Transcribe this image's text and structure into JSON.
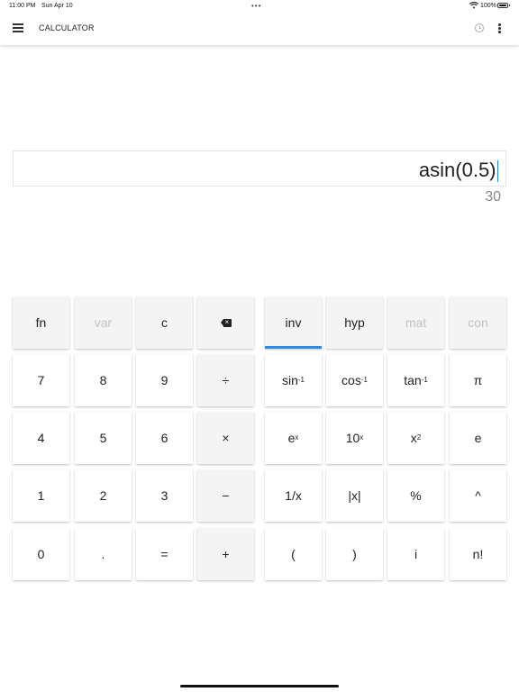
{
  "status_bar": {
    "time": "11:00 PM",
    "date": "Sun Apr 10",
    "battery": "100%",
    "battery_level": 1.0
  },
  "app_bar": {
    "title": "CALCULATOR",
    "icons": [
      "menu-icon",
      "history-icon",
      "more-vert-icon"
    ]
  },
  "display": {
    "expression": "asin(0.5)",
    "result": "30"
  },
  "accent_color": "#2a8ae4",
  "keypad": {
    "left": {
      "top_row": [
        {
          "label": "fn",
          "state": "normal"
        },
        {
          "label": "var",
          "state": "disabled"
        },
        {
          "label": "c",
          "state": "normal"
        },
        {
          "icon": "backspace-icon",
          "state": "normal"
        }
      ],
      "row_7": [
        "7",
        "8",
        "9",
        "÷"
      ],
      "row_4": [
        "4",
        "5",
        "6",
        "×"
      ],
      "row_1": [
        "1",
        "2",
        "3",
        "−"
      ],
      "row_0": [
        "0",
        ".",
        "=",
        "+"
      ]
    },
    "right": {
      "top_row": [
        {
          "label": "inv",
          "state": "active"
        },
        {
          "label": "hyp",
          "state": "normal"
        },
        {
          "label": "mat",
          "state": "disabled"
        },
        {
          "label": "con",
          "state": "disabled"
        }
      ],
      "row_trig": [
        {
          "base": "sin",
          "sup": "-1"
        },
        {
          "base": "cos",
          "sup": "-1"
        },
        {
          "base": "tan",
          "sup": "-1"
        },
        {
          "base": "π",
          "sup": ""
        }
      ],
      "row_exp": [
        {
          "base": "e",
          "sup": "x"
        },
        {
          "base": "10",
          "sup": "x"
        },
        {
          "base": "x",
          "sup": "2"
        },
        {
          "base": "e",
          "sup": ""
        }
      ],
      "row_misc": [
        "1/x",
        "|x|",
        "%",
        "^"
      ],
      "row_bottom": [
        "(",
        ")",
        "i",
        "n!"
      ]
    }
  }
}
